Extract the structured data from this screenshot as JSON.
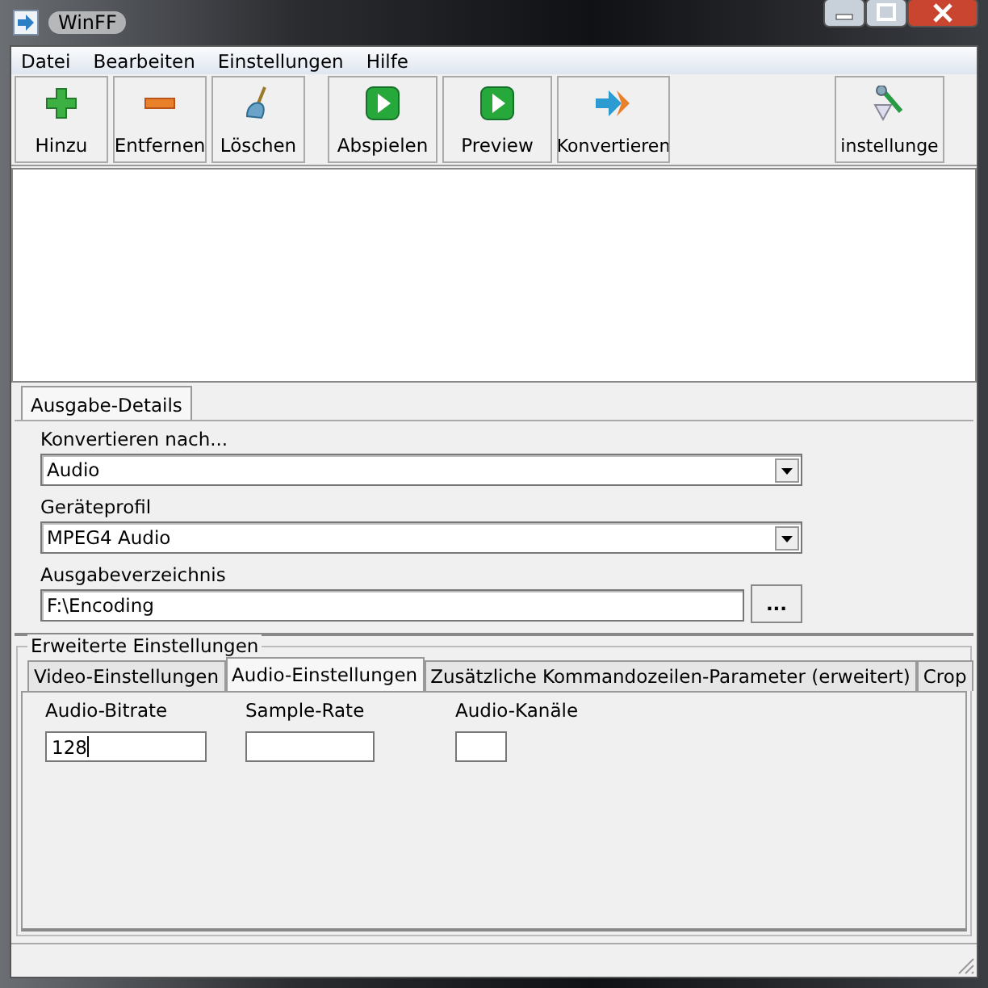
{
  "window": {
    "title": "WinFF"
  },
  "menu": [
    "Datei",
    "Bearbeiten",
    "Einstellungen",
    "Hilfe"
  ],
  "toolbar": {
    "groups": [
      [
        {
          "label": "Hinzu",
          "kind": "add"
        },
        {
          "label": "Entfernen",
          "kind": "remove"
        },
        {
          "label": "Löschen",
          "kind": "clear"
        }
      ],
      [
        {
          "label": "Abspielen",
          "kind": "play"
        },
        {
          "label": "Preview",
          "kind": "play"
        },
        {
          "label": "Konvertieren",
          "kind": "convert"
        }
      ],
      [
        {
          "label": "instellunge",
          "kind": "settings"
        }
      ]
    ]
  },
  "output_tabs": [
    {
      "label": "Ausgabe-Details",
      "selected": true
    }
  ],
  "output_fields": [
    {
      "label": "Konvertieren nach...",
      "value": "Audio",
      "kind": "dropdown"
    },
    {
      "label": "Geräteprofil",
      "value": "MPEG4 Audio",
      "kind": "dropdown"
    },
    {
      "label": "Ausgabeverzeichnis",
      "value": "F:\\Encoding",
      "kind": "browse",
      "button": "..."
    }
  ],
  "advanced": {
    "title": "Erweiterte Einstellungen",
    "tabs": [
      {
        "label": "Video-Einstellungen",
        "selected": false
      },
      {
        "label": "Audio-Einstellungen",
        "selected": true
      },
      {
        "label": "Zusätzliche Kommandozeilen-Parameter (erweitert)",
        "selected": false
      },
      {
        "label": "Crop",
        "selected": false
      }
    ],
    "fields": [
      {
        "label": "Audio-Bitrate",
        "value": "128",
        "focused": true
      },
      {
        "label": "Sample-Rate",
        "focused": false
      },
      {
        "label": "Audio-Kanäle",
        "focused": false
      }
    ]
  }
}
